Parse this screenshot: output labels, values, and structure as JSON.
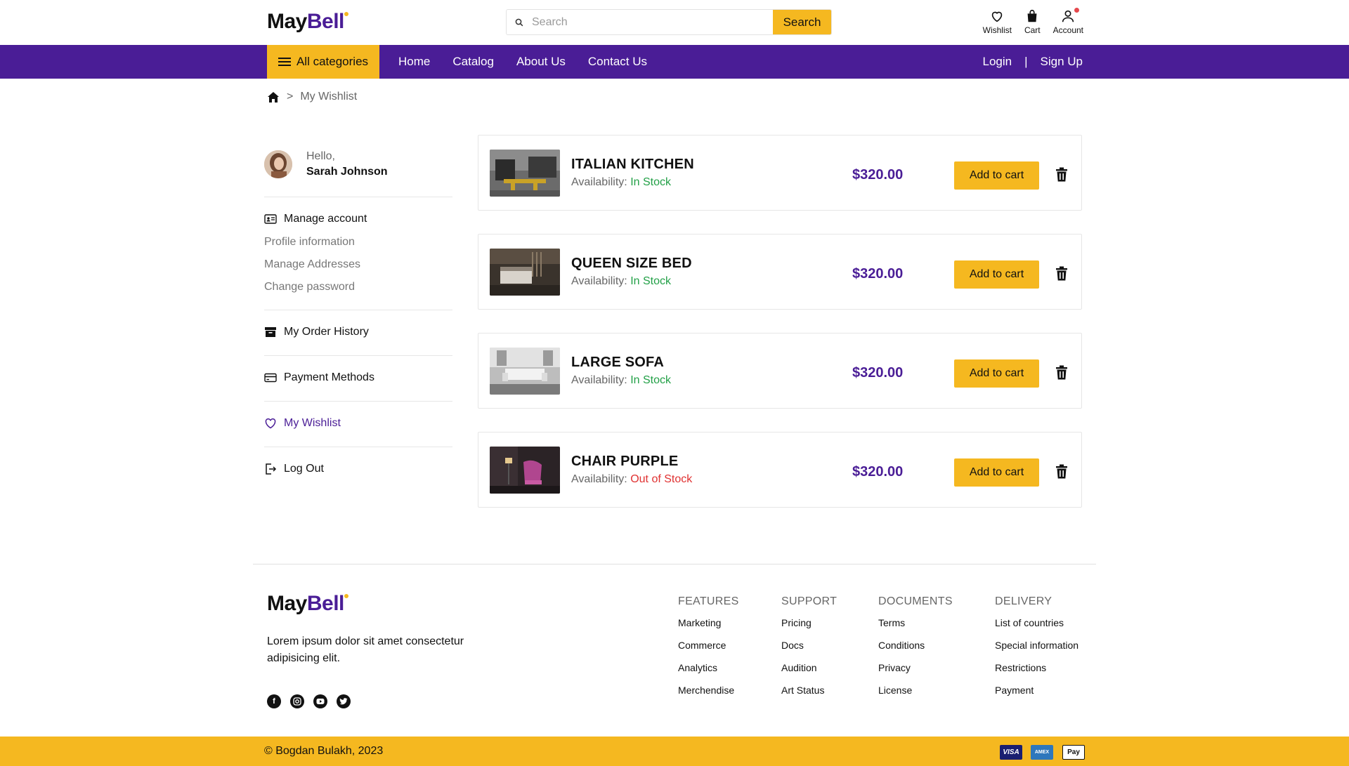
{
  "brand": {
    "part1": "May",
    "part2": "Bell"
  },
  "search": {
    "placeholder": "Search",
    "button": "Search"
  },
  "header_icons": {
    "wishlist": "Wishlist",
    "cart": "Cart",
    "account": "Account"
  },
  "nav": {
    "all_categories": "All categories",
    "links": [
      "Home",
      "Catalog",
      "About Us",
      "Contact Us"
    ],
    "login": "Login",
    "separator": "|",
    "signup": "Sign Up"
  },
  "breadcrumb": {
    "separator": ">",
    "current": "My Wishlist"
  },
  "profile": {
    "hello": "Hello,",
    "name": "Sarah Johnson"
  },
  "sidebar": {
    "manage_account": "Manage account",
    "profile_information": "Profile information",
    "manage_addresses": "Manage Addresses",
    "change_password": "Change password",
    "order_history": "My Order History",
    "payment_methods": "Payment Methods",
    "wishlist": "My Wishlist",
    "logout": "Log Out"
  },
  "wishlist": {
    "availability_label": "Availability:",
    "add_to_cart": "Add to cart",
    "items": [
      {
        "title": "ITALIAN KITCHEN",
        "status": "In Stock",
        "price": "$320.00"
      },
      {
        "title": "QUEEN SIZE BED",
        "status": "In Stock",
        "price": "$320.00"
      },
      {
        "title": "LARGE SOFA",
        "status": "In Stock",
        "price": "$320.00"
      },
      {
        "title": "CHAIR PURPLE",
        "status": "Out of Stock",
        "price": "$320.00"
      }
    ]
  },
  "footer": {
    "description": "Lorem ipsum dolor sit amet consectetur adipisicing elit.",
    "columns": [
      {
        "heading": "FEATURES",
        "items": [
          "Marketing",
          "Commerce",
          "Analytics",
          "Merchendise"
        ]
      },
      {
        "heading": "SUPPORT",
        "items": [
          "Pricing",
          "Docs",
          "Audition",
          "Art Status"
        ]
      },
      {
        "heading": "DOCUMENTS",
        "items": [
          "Terms",
          "Conditions",
          "Privacy",
          "License"
        ]
      },
      {
        "heading": "DELIVERY",
        "items": [
          "List of countries",
          "Special information",
          "Restrictions",
          "Payment"
        ]
      }
    ],
    "copyright": "© Bogdan Bulakh, 2023",
    "payment_badges": {
      "visa": "VISA",
      "amex": "AMEX",
      "applepay": "Pay"
    }
  },
  "colors": {
    "primary": "#4a1d96",
    "accent": "#f5b820",
    "in_stock": "#22a047",
    "out_of_stock": "#e03131"
  }
}
